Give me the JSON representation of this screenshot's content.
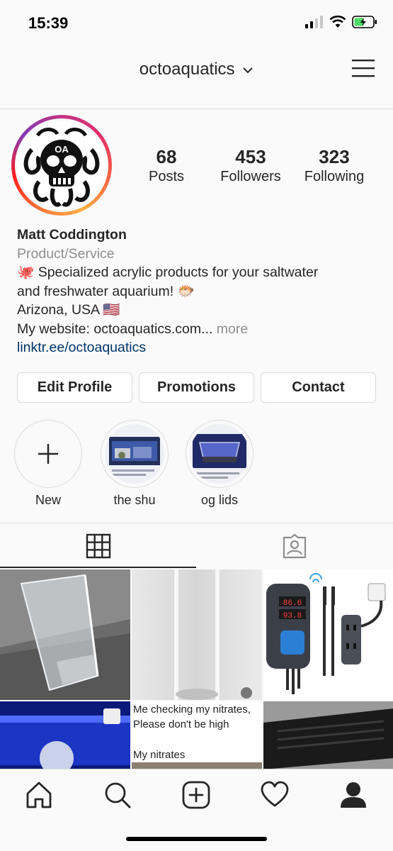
{
  "status": {
    "time": "15:39"
  },
  "header": {
    "username": "octoaquatics"
  },
  "profile": {
    "posts_count": "68",
    "posts_label": "Posts",
    "followers_count": "453",
    "followers_label": "Followers",
    "following_count": "323",
    "following_label": "Following",
    "name": "Matt Coddington",
    "category": "Product/Service",
    "bio_line1": "🐙 Specialized acrylic products for your saltwater",
    "bio_line2": "and freshwater aquarium! 🐡",
    "location": "Arizona, USA 🇺🇸",
    "website_prefix": "My website: octoaquatics.com...",
    "more_label": "more",
    "link": "linktr.ee/octoaquatics"
  },
  "buttons": {
    "edit_profile": "Edit Profile",
    "promotions": "Promotions",
    "contact": "Contact"
  },
  "highlights": [
    {
      "label": "New"
    },
    {
      "label": "the shu"
    },
    {
      "label": "og lids"
    }
  ],
  "grid": {
    "meme_line1": "Me checking my nitrates,",
    "meme_line2": "Please don't be high",
    "meme_line3": "My nitrates",
    "thermo_reading1": "86.6",
    "thermo_reading2": "93.8"
  },
  "icons": {
    "grid_tab": "grid-icon",
    "tagged_tab": "tagged-icon",
    "home": "home-icon",
    "search": "search-icon",
    "add": "add-post-icon",
    "activity": "heart-icon",
    "profile": "profile-icon"
  },
  "colors": {
    "link": "#003569",
    "muted": "#8e8e8e",
    "border": "#dbdbdb",
    "battery": "#4cd964"
  }
}
